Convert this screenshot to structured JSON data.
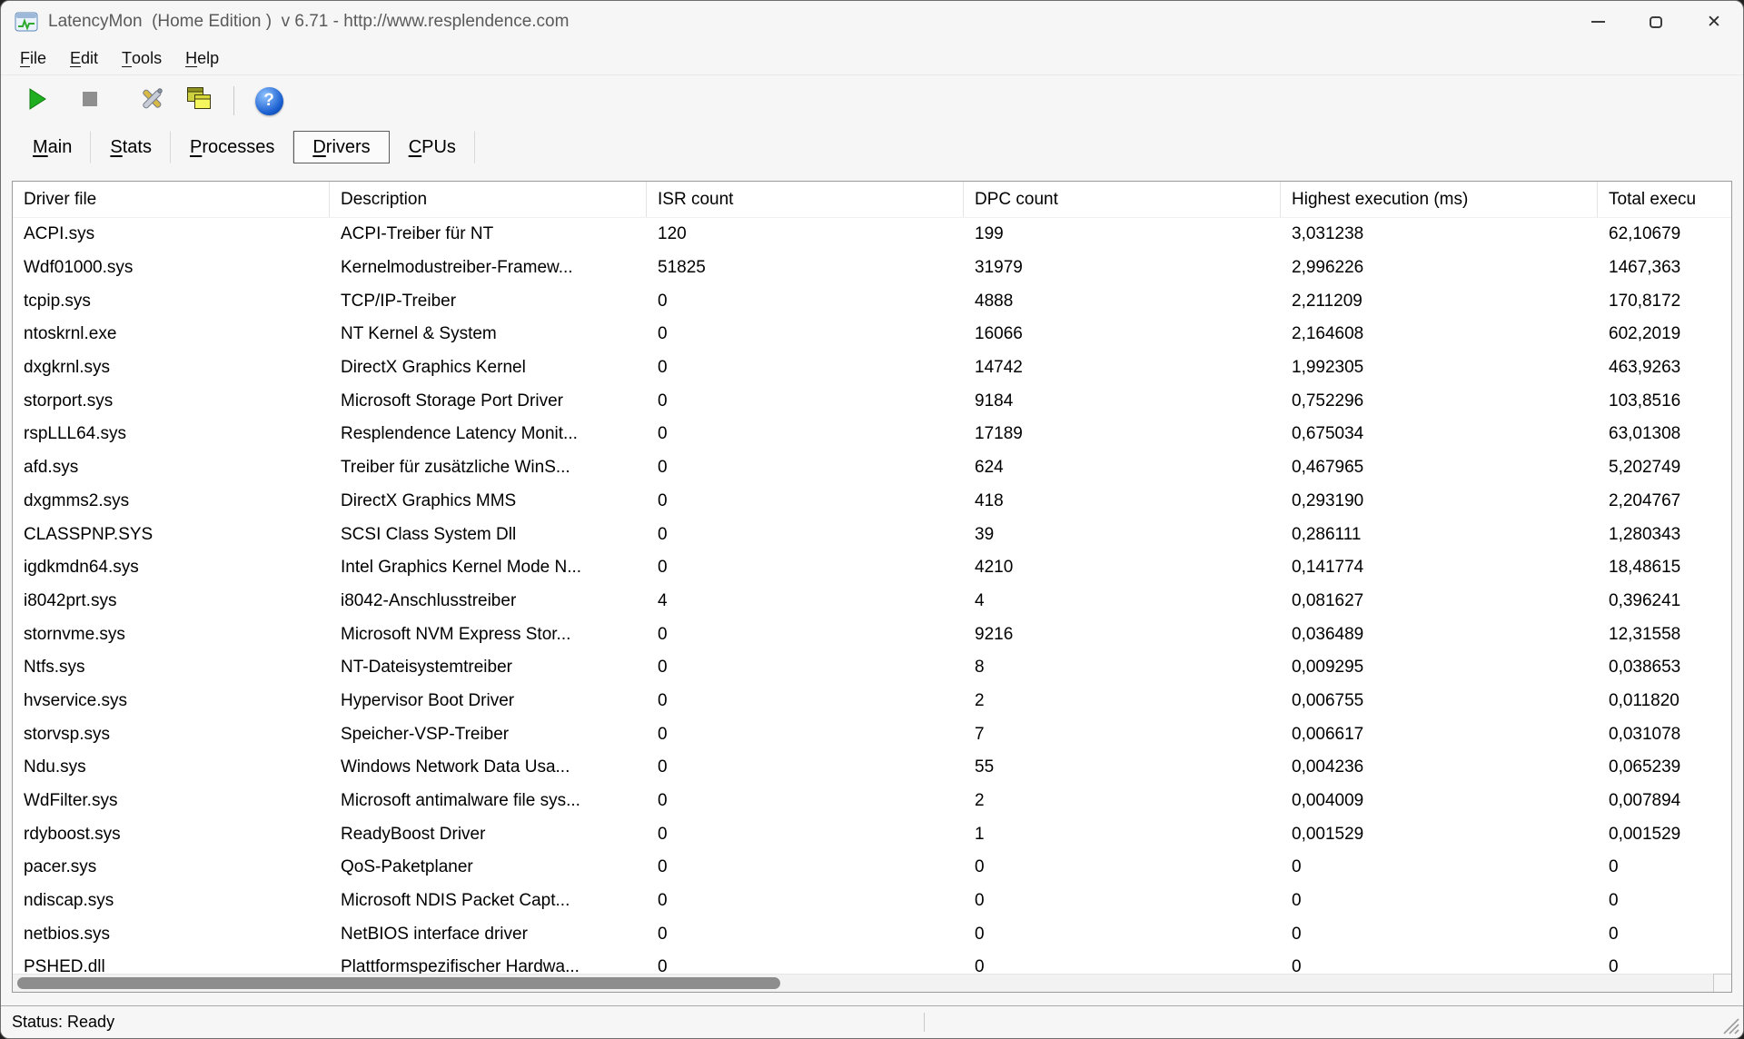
{
  "colors": {
    "play_green": "#1fae1f",
    "stop_gray": "#8f8f8f",
    "help_blue": "#1a5fd0",
    "accent_border": "#5c5c5c"
  },
  "window": {
    "title": "LatencyMon  (Home Edition )  v 6.71 - http://www.resplendence.com",
    "close_glyph": "✕"
  },
  "menu": {
    "items": [
      {
        "label": "File"
      },
      {
        "label": "Edit"
      },
      {
        "label": "Tools"
      },
      {
        "label": "Help"
      }
    ]
  },
  "toolbar": {
    "help_glyph": "?"
  },
  "tabs": [
    {
      "label": "Main",
      "active": false
    },
    {
      "label": "Stats",
      "active": false
    },
    {
      "label": "Processes",
      "active": false
    },
    {
      "label": "Drivers",
      "active": true
    },
    {
      "label": "CPUs",
      "active": false
    }
  ],
  "table": {
    "columns": [
      "Driver file",
      "Description",
      "ISR count",
      "DPC count",
      "Highest execution (ms)",
      "Total execu"
    ],
    "column_keys": [
      "driver_file",
      "description",
      "isr_count",
      "dpc_count",
      "highest_execution_ms",
      "total_execution"
    ],
    "rows": [
      [
        "ACPI.sys",
        "ACPI-Treiber für NT",
        "120",
        "199",
        "3,031238",
        "62,10679"
      ],
      [
        "Wdf01000.sys",
        "Kernelmodustreiber-Framew...",
        "51825",
        "31979",
        "2,996226",
        "1467,363"
      ],
      [
        "tcpip.sys",
        "TCP/IP-Treiber",
        "0",
        "4888",
        "2,211209",
        "170,8172"
      ],
      [
        "ntoskrnl.exe",
        "NT Kernel & System",
        "0",
        "16066",
        "2,164608",
        "602,2019"
      ],
      [
        "dxgkrnl.sys",
        "DirectX Graphics Kernel",
        "0",
        "14742",
        "1,992305",
        "463,9263"
      ],
      [
        "storport.sys",
        "Microsoft Storage Port Driver",
        "0",
        "9184",
        "0,752296",
        "103,8516"
      ],
      [
        "rspLLL64.sys",
        "Resplendence Latency Monit...",
        "0",
        "17189",
        "0,675034",
        "63,01308"
      ],
      [
        "afd.sys",
        "Treiber für zusätzliche WinS...",
        "0",
        "624",
        "0,467965",
        "5,202749"
      ],
      [
        "dxgmms2.sys",
        "DirectX Graphics MMS",
        "0",
        "418",
        "0,293190",
        "2,204767"
      ],
      [
        "CLASSPNP.SYS",
        "SCSI Class System Dll",
        "0",
        "39",
        "0,286111",
        "1,280343"
      ],
      [
        "igdkmdn64.sys",
        "Intel Graphics Kernel Mode N...",
        "0",
        "4210",
        "0,141774",
        "18,48615"
      ],
      [
        "i8042prt.sys",
        "i8042-Anschlusstreiber",
        "4",
        "4",
        "0,081627",
        "0,396241"
      ],
      [
        "stornvme.sys",
        "Microsoft NVM Express Stor...",
        "0",
        "9216",
        "0,036489",
        "12,31558"
      ],
      [
        "Ntfs.sys",
        "NT-Dateisystemtreiber",
        "0",
        "8",
        "0,009295",
        "0,038653"
      ],
      [
        "hvservice.sys",
        "Hypervisor Boot Driver",
        "0",
        "2",
        "0,006755",
        "0,011820"
      ],
      [
        "storvsp.sys",
        "Speicher-VSP-Treiber",
        "0",
        "7",
        "0,006617",
        "0,031078"
      ],
      [
        "Ndu.sys",
        "Windows Network Data Usa...",
        "0",
        "55",
        "0,004236",
        "0,065239"
      ],
      [
        "WdFilter.sys",
        "Microsoft antimalware file sys...",
        "0",
        "2",
        "0,004009",
        "0,007894"
      ],
      [
        "rdyboost.sys",
        "ReadyBoost Driver",
        "0",
        "1",
        "0,001529",
        "0,001529"
      ],
      [
        "pacer.sys",
        "QoS-Paketplaner",
        "0",
        "0",
        "0",
        "0"
      ],
      [
        "ndiscap.sys",
        "Microsoft NDIS Packet Capt...",
        "0",
        "0",
        "0",
        "0"
      ],
      [
        "netbios.sys",
        "NetBIOS interface driver",
        "0",
        "0",
        "0",
        "0"
      ],
      [
        "PSHED.dll",
        "Plattformspezifischer Hardwa...",
        "0",
        "0",
        "0",
        "0"
      ]
    ]
  },
  "status": {
    "text": "Status: Ready"
  }
}
